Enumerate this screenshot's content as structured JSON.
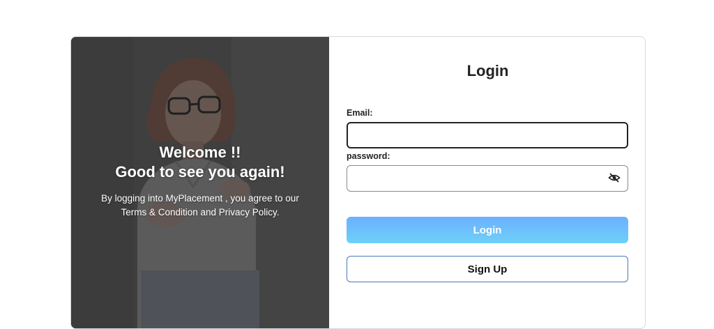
{
  "hero": {
    "title_line1": "Welcome !!",
    "title_line2": "Good to see you again!",
    "desc_line1": "By logging into MyPlacement , you agree to our",
    "desc_line2": "Terms & Condition and Privacy Policy."
  },
  "form": {
    "title": "Login",
    "email_label": "Email:",
    "email_value": "",
    "password_label": "password:",
    "password_value": "",
    "login_label": "Login",
    "signup_label": "Sign Up"
  },
  "icons": {
    "password_toggle": "eye-slash-icon"
  },
  "colors": {
    "login_gradient_top": "#6ab0ff",
    "login_gradient_bottom": "#6fd0f7",
    "signup_border": "#4a78b8"
  }
}
